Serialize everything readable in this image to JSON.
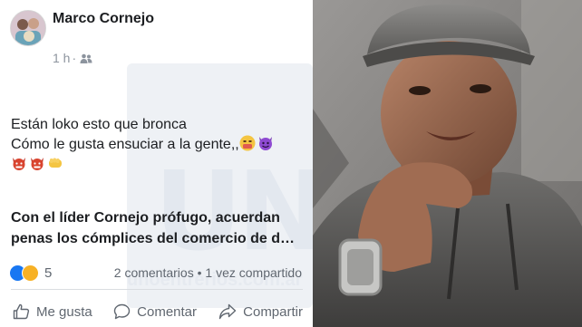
{
  "post": {
    "author": "Marco Cornejo",
    "time": "1 h",
    "separator": "·",
    "privacy_icon": "friends-icon",
    "text_lines": [
      "Están loko esto que bronca",
      "Cómo le gusta ensuciar a la gente,,"
    ],
    "emojis_line2": [
      "face-with-symbols",
      "smiling-imp"
    ],
    "emojis_line3": [
      "ogre-mask",
      "ogre-mask",
      "oncoming-fist"
    ],
    "link_title_lines": [
      "Con el líder Cornejo prófugo, acuerdan",
      "penas los cómplices del comercio de d…"
    ],
    "reactions": [
      "like",
      "angry"
    ],
    "reaction_count": "5",
    "comments": "2 comentarios",
    "stats_separator": " • ",
    "shares": "1 vez compartido",
    "actions": {
      "like": "Me gusta",
      "comment": "Comentar",
      "share": "Compartir"
    }
  },
  "watermark": {
    "site": "unoentrerios.com.ar"
  },
  "colors": {
    "facebook_blue": "#1877f2",
    "text": "#1c1e21",
    "secondary": "#606770",
    "muted": "#8d949e"
  }
}
